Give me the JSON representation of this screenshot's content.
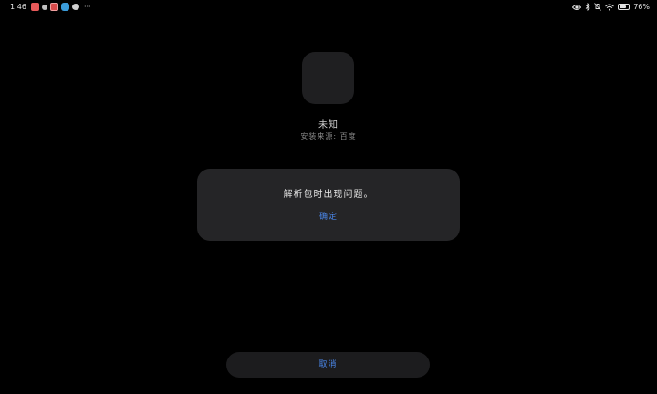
{
  "status_bar": {
    "time": "1:46",
    "battery_text": "76%",
    "battery_level": 0.76,
    "notification_icons": [
      "app-red-icon",
      "gear-icon",
      "app-red-icon",
      "app-blue-icon",
      "wechat-icon"
    ],
    "more": "···",
    "right_icons": [
      "eye-icon",
      "bluetooth-icon",
      "mute-icon",
      "wifi-icon",
      "battery-icon"
    ]
  },
  "app": {
    "name": "未知",
    "source": "安装来源: 百度"
  },
  "dialog": {
    "message": "解析包时出现问题。",
    "confirm_label": "确定"
  },
  "footer": {
    "cancel_label": "取消"
  },
  "colors": {
    "background": "#000000",
    "dialog": "#252527",
    "accent": "#4a86e8"
  }
}
